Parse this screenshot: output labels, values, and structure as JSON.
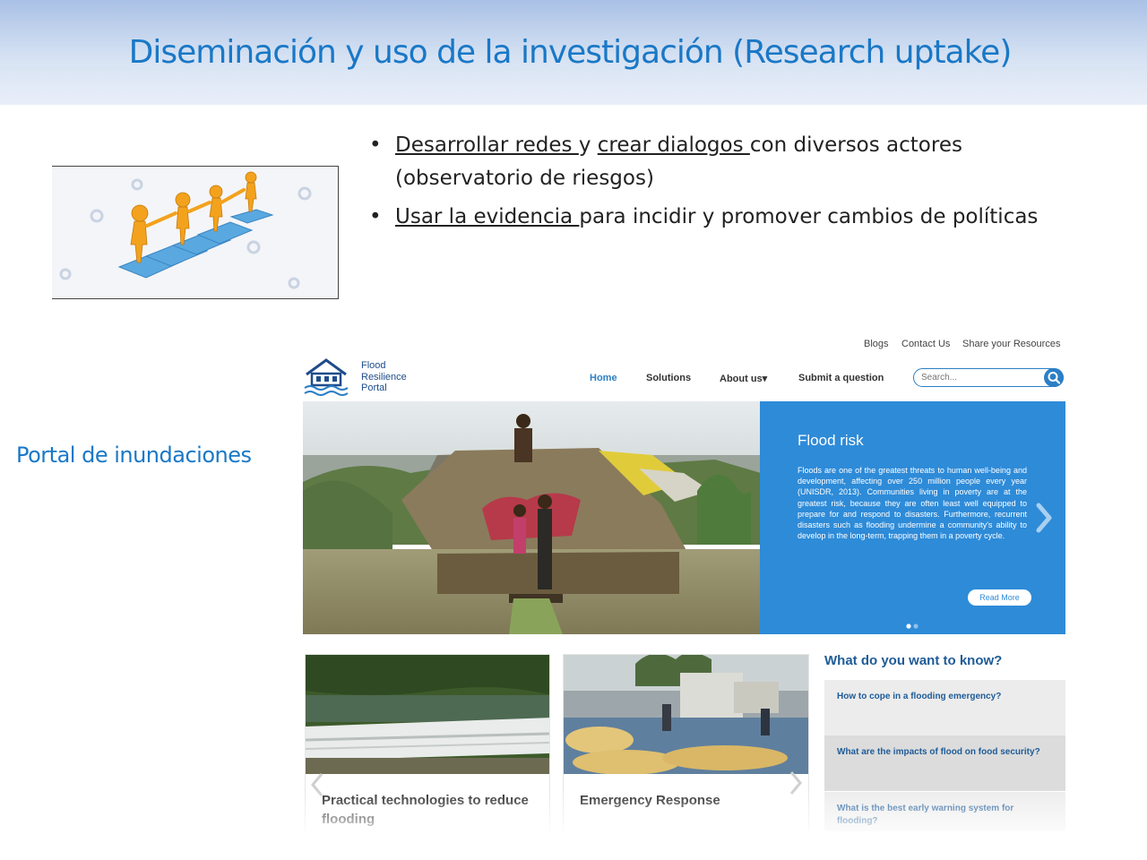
{
  "slide": {
    "title": "Diseminación y uso de la investigación (Research uptake)",
    "bullets": [
      {
        "marker": "•",
        "link1": "Desarrollar redes ",
        "text1": "y ",
        "link2": "crear dialogos ",
        "text2": "con diversos actores (observatorio de riesgos)"
      },
      {
        "marker": "•",
        "link1": "Usar la evidencia ",
        "text1": "para incidir y promover cambios de políticas"
      }
    ],
    "portal_label": "Portal de inundaciones"
  },
  "website": {
    "top_links": [
      "Blogs",
      "Contact Us",
      "Share your Resources"
    ],
    "logo": {
      "line1": "Flood",
      "line2": "Resilience",
      "line3": "Portal"
    },
    "nav": [
      {
        "label": "Home",
        "active": true
      },
      {
        "label": "Solutions",
        "active": false
      },
      {
        "label": "About us",
        "active": false,
        "caret": "▾"
      },
      {
        "label": "Submit a question",
        "active": false
      }
    ],
    "search": {
      "placeholder": "Search..."
    },
    "hero": {
      "title": "Flood risk",
      "body": "Floods are one of the greatest threats to human well-being and development, affecting over 250 million people every year (UNISDR, 2013). Communities living in poverty are at the greatest risk, because they are often least well equipped to prepare for and respond to disasters. Furthermore, recurrent disasters such as flooding undermine a community's ability to develop in the long-term, trapping them in a poverty cycle.",
      "button": "Read More",
      "slides_total": 2,
      "slide_active": 1
    },
    "cards": [
      {
        "title": "Practical technologies to reduce flooding"
      },
      {
        "title": "Emergency Response"
      }
    ],
    "faq": {
      "heading": "What do you want to know?",
      "items": [
        "How to cope in a flooding emergency?",
        "What are the impacts of flood on food security?",
        "What is the best early warning system for flooding?"
      ]
    },
    "colors": {
      "accent": "#2b7fc5",
      "hero_panel": "#2e8bd8",
      "faq_text": "#1e5b97",
      "slide_title": "#1a78c6"
    }
  }
}
